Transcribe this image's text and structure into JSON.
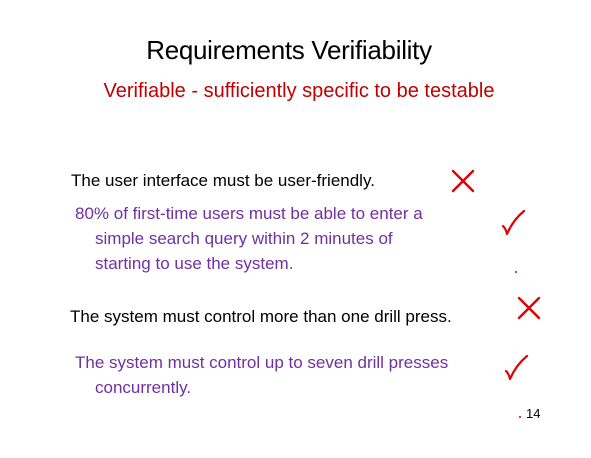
{
  "slide": {
    "title": "Requirements Verifiability",
    "subtitle": "Verifiable - sufficiently specific to be testable",
    "page_number": "14"
  },
  "requirements": [
    {
      "lines": [
        "The user interface must be user-friendly."
      ],
      "verifiable": false,
      "mark": "cross-icon"
    },
    {
      "lines": [
        "80% of first-time users must be able to enter a",
        "simple search query within 2 minutes of",
        "starting to use the system."
      ],
      "verifiable": true,
      "mark": "check-icon"
    },
    {
      "lines": [
        "The system must control more than one drill press."
      ],
      "verifiable": false,
      "mark": "cross-icon"
    },
    {
      "lines": [
        "The system must control up to seven drill presses",
        "concurrently."
      ],
      "verifiable": true,
      "mark": "check-icon"
    }
  ],
  "colors": {
    "title": "#000000",
    "subtitle": "#c00000",
    "unverifiable_text": "#000000",
    "verifiable_text": "#7030a0",
    "marks": "#e00000"
  }
}
